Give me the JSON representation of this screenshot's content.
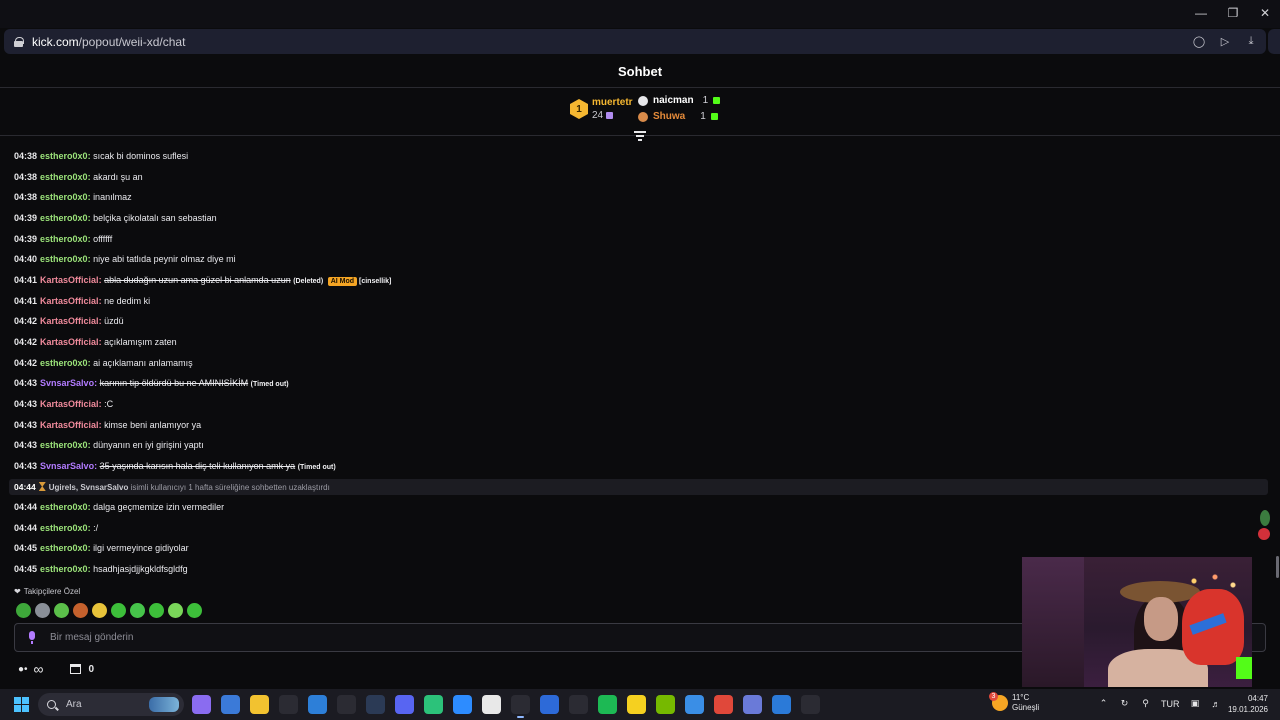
{
  "browser": {
    "url_domain": "kick.com",
    "url_path": "/popout/weii-xd/chat"
  },
  "chat": {
    "title": "Sohbet",
    "leaderboard": {
      "first": {
        "rank": "1",
        "name": "muertetr",
        "count": "24"
      },
      "others": [
        {
          "name": "naicman",
          "count": "1"
        },
        {
          "name": "Shuwa",
          "count": "1"
        }
      ]
    },
    "messages": [
      {
        "time": "04:38",
        "user": "esthero0x0",
        "color": "#9be37a",
        "text": "sıcak bi dominos suflesi"
      },
      {
        "time": "04:38",
        "user": "esthero0x0",
        "color": "#9be37a",
        "text": "akardı şu an"
      },
      {
        "time": "04:38",
        "user": "esthero0x0",
        "color": "#9be37a",
        "text": "inanılmaz"
      },
      {
        "time": "04:39",
        "user": "esthero0x0",
        "color": "#9be37a",
        "text": "belçika çikolatalı san sebastian"
      },
      {
        "time": "04:39",
        "user": "esthero0x0",
        "color": "#9be37a",
        "text": "offffff"
      },
      {
        "time": "04:40",
        "user": "esthero0x0",
        "color": "#9be37a",
        "text": "niye abi tatlıda peynir olmaz diye mi"
      },
      {
        "time": "04:41",
        "user": "KartasOfficial",
        "color": "#ef8a9b",
        "text": "abla dudağın uzun ama güzel bi anlamda uzun",
        "deleted": true,
        "tag": "(Deleted)",
        "badge": "AI Mod",
        "reason": "[cinsellik]"
      },
      {
        "time": "04:41",
        "user": "KartasOfficial",
        "color": "#ef8a9b",
        "text": "ne dedim ki"
      },
      {
        "time": "04:42",
        "user": "KartasOfficial",
        "color": "#ef8a9b",
        "text": "üzdü"
      },
      {
        "time": "04:42",
        "user": "KartasOfficial",
        "color": "#ef8a9b",
        "text": "açıklamışım zaten"
      },
      {
        "time": "04:42",
        "user": "esthero0x0",
        "color": "#9be37a",
        "text": "ai açıklamanı anlamamış"
      },
      {
        "time": "04:43",
        "user": "SvnsarSalvo",
        "color": "#b27bff",
        "text": "karının tip öldürdü bu ne AMINISİKİM",
        "deleted": true,
        "tag": "(Timed out)"
      },
      {
        "time": "04:43",
        "user": "KartasOfficial",
        "color": "#ef8a9b",
        "text": ":C"
      },
      {
        "time": "04:43",
        "user": "KartasOfficial",
        "color": "#ef8a9b",
        "text": "kimse beni anlamıyor ya"
      },
      {
        "time": "04:43",
        "user": "esthero0x0",
        "color": "#9be37a",
        "text": "dünyanın en iyi girişini yaptı"
      },
      {
        "time": "04:43",
        "user": "SvnsarSalvo",
        "color": "#b27bff",
        "text": "35 yaşında karısın hala diş teli kullanıyon amk ya",
        "deleted": true,
        "tag": "(Timed out)"
      }
    ],
    "system": {
      "time": "04:44",
      "names": "Ugirels, SvnsarSalvo",
      "text": "isimli kullanıcıyı 1 hafta süreliğine sohbetten uzaklaştırdı"
    },
    "messages_after": [
      {
        "time": "04:44",
        "user": "esthero0x0",
        "color": "#9be37a",
        "text": "dalga geçmemize izin vermediler"
      },
      {
        "time": "04:44",
        "user": "esthero0x0",
        "color": "#9be37a",
        "text": ":/"
      },
      {
        "time": "04:45",
        "user": "esthero0x0",
        "color": "#9be37a",
        "text": "ilgi vermeyince gidiyolar"
      },
      {
        "time": "04:45",
        "user": "esthero0x0",
        "color": "#9be37a",
        "text": "hsadhjasjdjjkgkldfsgldfg"
      }
    ],
    "emotes_label": "Takipçilere Özel",
    "emotes": [
      "#3ea83a",
      "#8a8f98",
      "#5bbf4a",
      "#c5612d",
      "#e8c33a",
      "#3dbf3a",
      "#46c44a",
      "#3dbf3a",
      "#7ad65a",
      "#3dbf3a"
    ],
    "input_placeholder": "Bir mesaj gönderin",
    "points": "0"
  },
  "taskbar": {
    "search_text": "Ara",
    "weather_badge": "3",
    "weather_temp": "11°C",
    "weather_desc": "Güneşli",
    "language": "TUR",
    "time": "04:47",
    "date": "19.01.2026",
    "apps": [
      "#8a6cf0",
      "#3b7ad8",
      "#f2c230",
      "#2b2b33",
      "#2d7fd8",
      "#2b2b33",
      "#2b3a55",
      "#5865f2",
      "#2cc27a",
      "#2d8cff",
      "#e8e8e8",
      "#2b2b33",
      "#2d6ad8",
      "#2b2b33",
      "#1db954",
      "#f5d020",
      "#76b900",
      "#3a8ee6",
      "#e0483a",
      "#6a7ad8",
      "#2b7ad8",
      "#2b2b33"
    ]
  }
}
